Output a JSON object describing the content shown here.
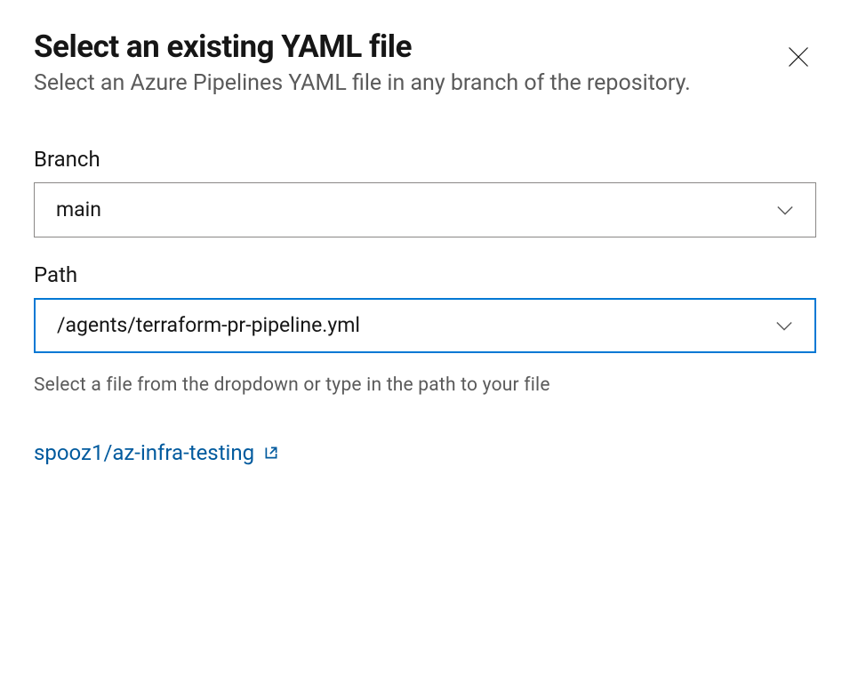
{
  "header": {
    "title": "Select an existing YAML file",
    "subtitle": "Select an Azure Pipelines YAML file in any branch of the repository."
  },
  "branch": {
    "label": "Branch",
    "value": "main"
  },
  "path": {
    "label": "Path",
    "value": "/agents/terraform-pr-pipeline.yml",
    "helper": "Select a file from the dropdown or type in the path to your file"
  },
  "repoLink": {
    "text": "spooz1/az-infra-testing"
  }
}
